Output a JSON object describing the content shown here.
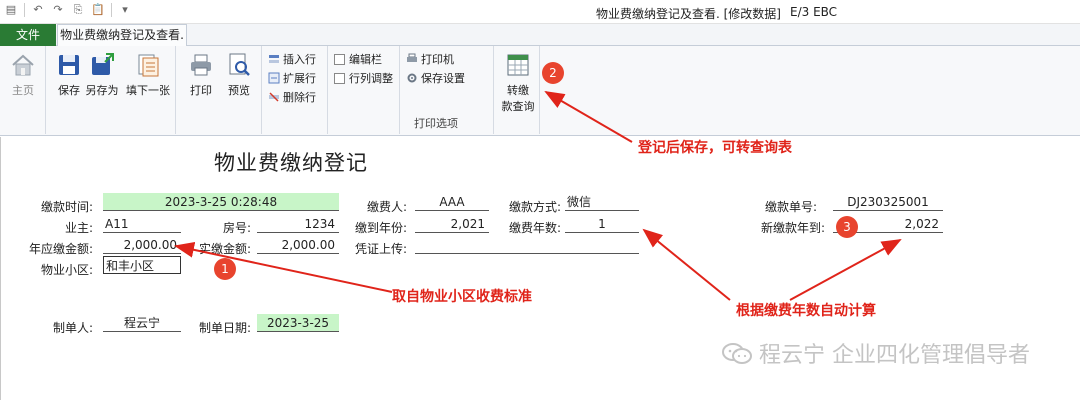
{
  "titlebar": {
    "title": "物业费缴纳登记及查看. [修改数据]",
    "app": "E/3 EBC"
  },
  "tabs": {
    "file": "文件",
    "main": "物业费缴纳登记及查看."
  },
  "ribbon": {
    "home": "主页",
    "save": "保存",
    "save_as": "另存为",
    "fill_next": "填下一张",
    "print": "打印",
    "preview": "预览",
    "insert_row": "插入行",
    "expand_row": "扩展行",
    "delete_row": "删除行",
    "edit_bar": "编辑栏",
    "row_col_adjust": "行列调整",
    "printer": "打印机",
    "save_settings": "保存设置",
    "print_options": "打印选项",
    "transfer_line1": "转缴",
    "transfer_line2": "款查询"
  },
  "form": {
    "title": "物业费缴纳登记",
    "payment_time_label": "缴款时间:",
    "payment_time": "2023-3-25 0:28:48",
    "owner_label": "业主:",
    "owner": "A11",
    "room_label": "房号:",
    "room": "1234",
    "annual_due_label": "年应缴金额:",
    "annual_due": "2,000.00",
    "actual_paid_label": "实缴金额:",
    "actual_paid": "2,000.00",
    "community_label": "物业小区:",
    "community": "和丰小区",
    "payer_label": "缴费人:",
    "payer": "AAA",
    "method_label": "缴款方式:",
    "method": "微信",
    "paid_to_year_label": "缴到年份:",
    "paid_to_year": "2,021",
    "years_label": "缴费年数:",
    "years": "1",
    "voucher_label": "凭证上传:",
    "voucher": "",
    "receipt_no_label": "缴款单号:",
    "receipt_no": "DJ230325001",
    "new_paid_to_label": "新缴款年到:",
    "new_paid_to": "2,022",
    "maker_label": "制单人:",
    "maker": "程云宁",
    "make_date_label": "制单日期:",
    "make_date": "2023-3-25"
  },
  "annotations": {
    "m1": "1",
    "m2": "2",
    "m3": "3",
    "note2": "登记后保存，可转查询表",
    "note1": "取自物业小区收费标准",
    "note3": "根据缴费年数自动计算"
  },
  "watermark": {
    "text": "程云宁 企业四化管理倡导者",
    "icon": "wechat-icon"
  },
  "colors": {
    "file_tab": "#2a7b34",
    "highlight_field": "#c8f5c8",
    "annotation": "#e0241a",
    "marker": "#e8442e"
  }
}
